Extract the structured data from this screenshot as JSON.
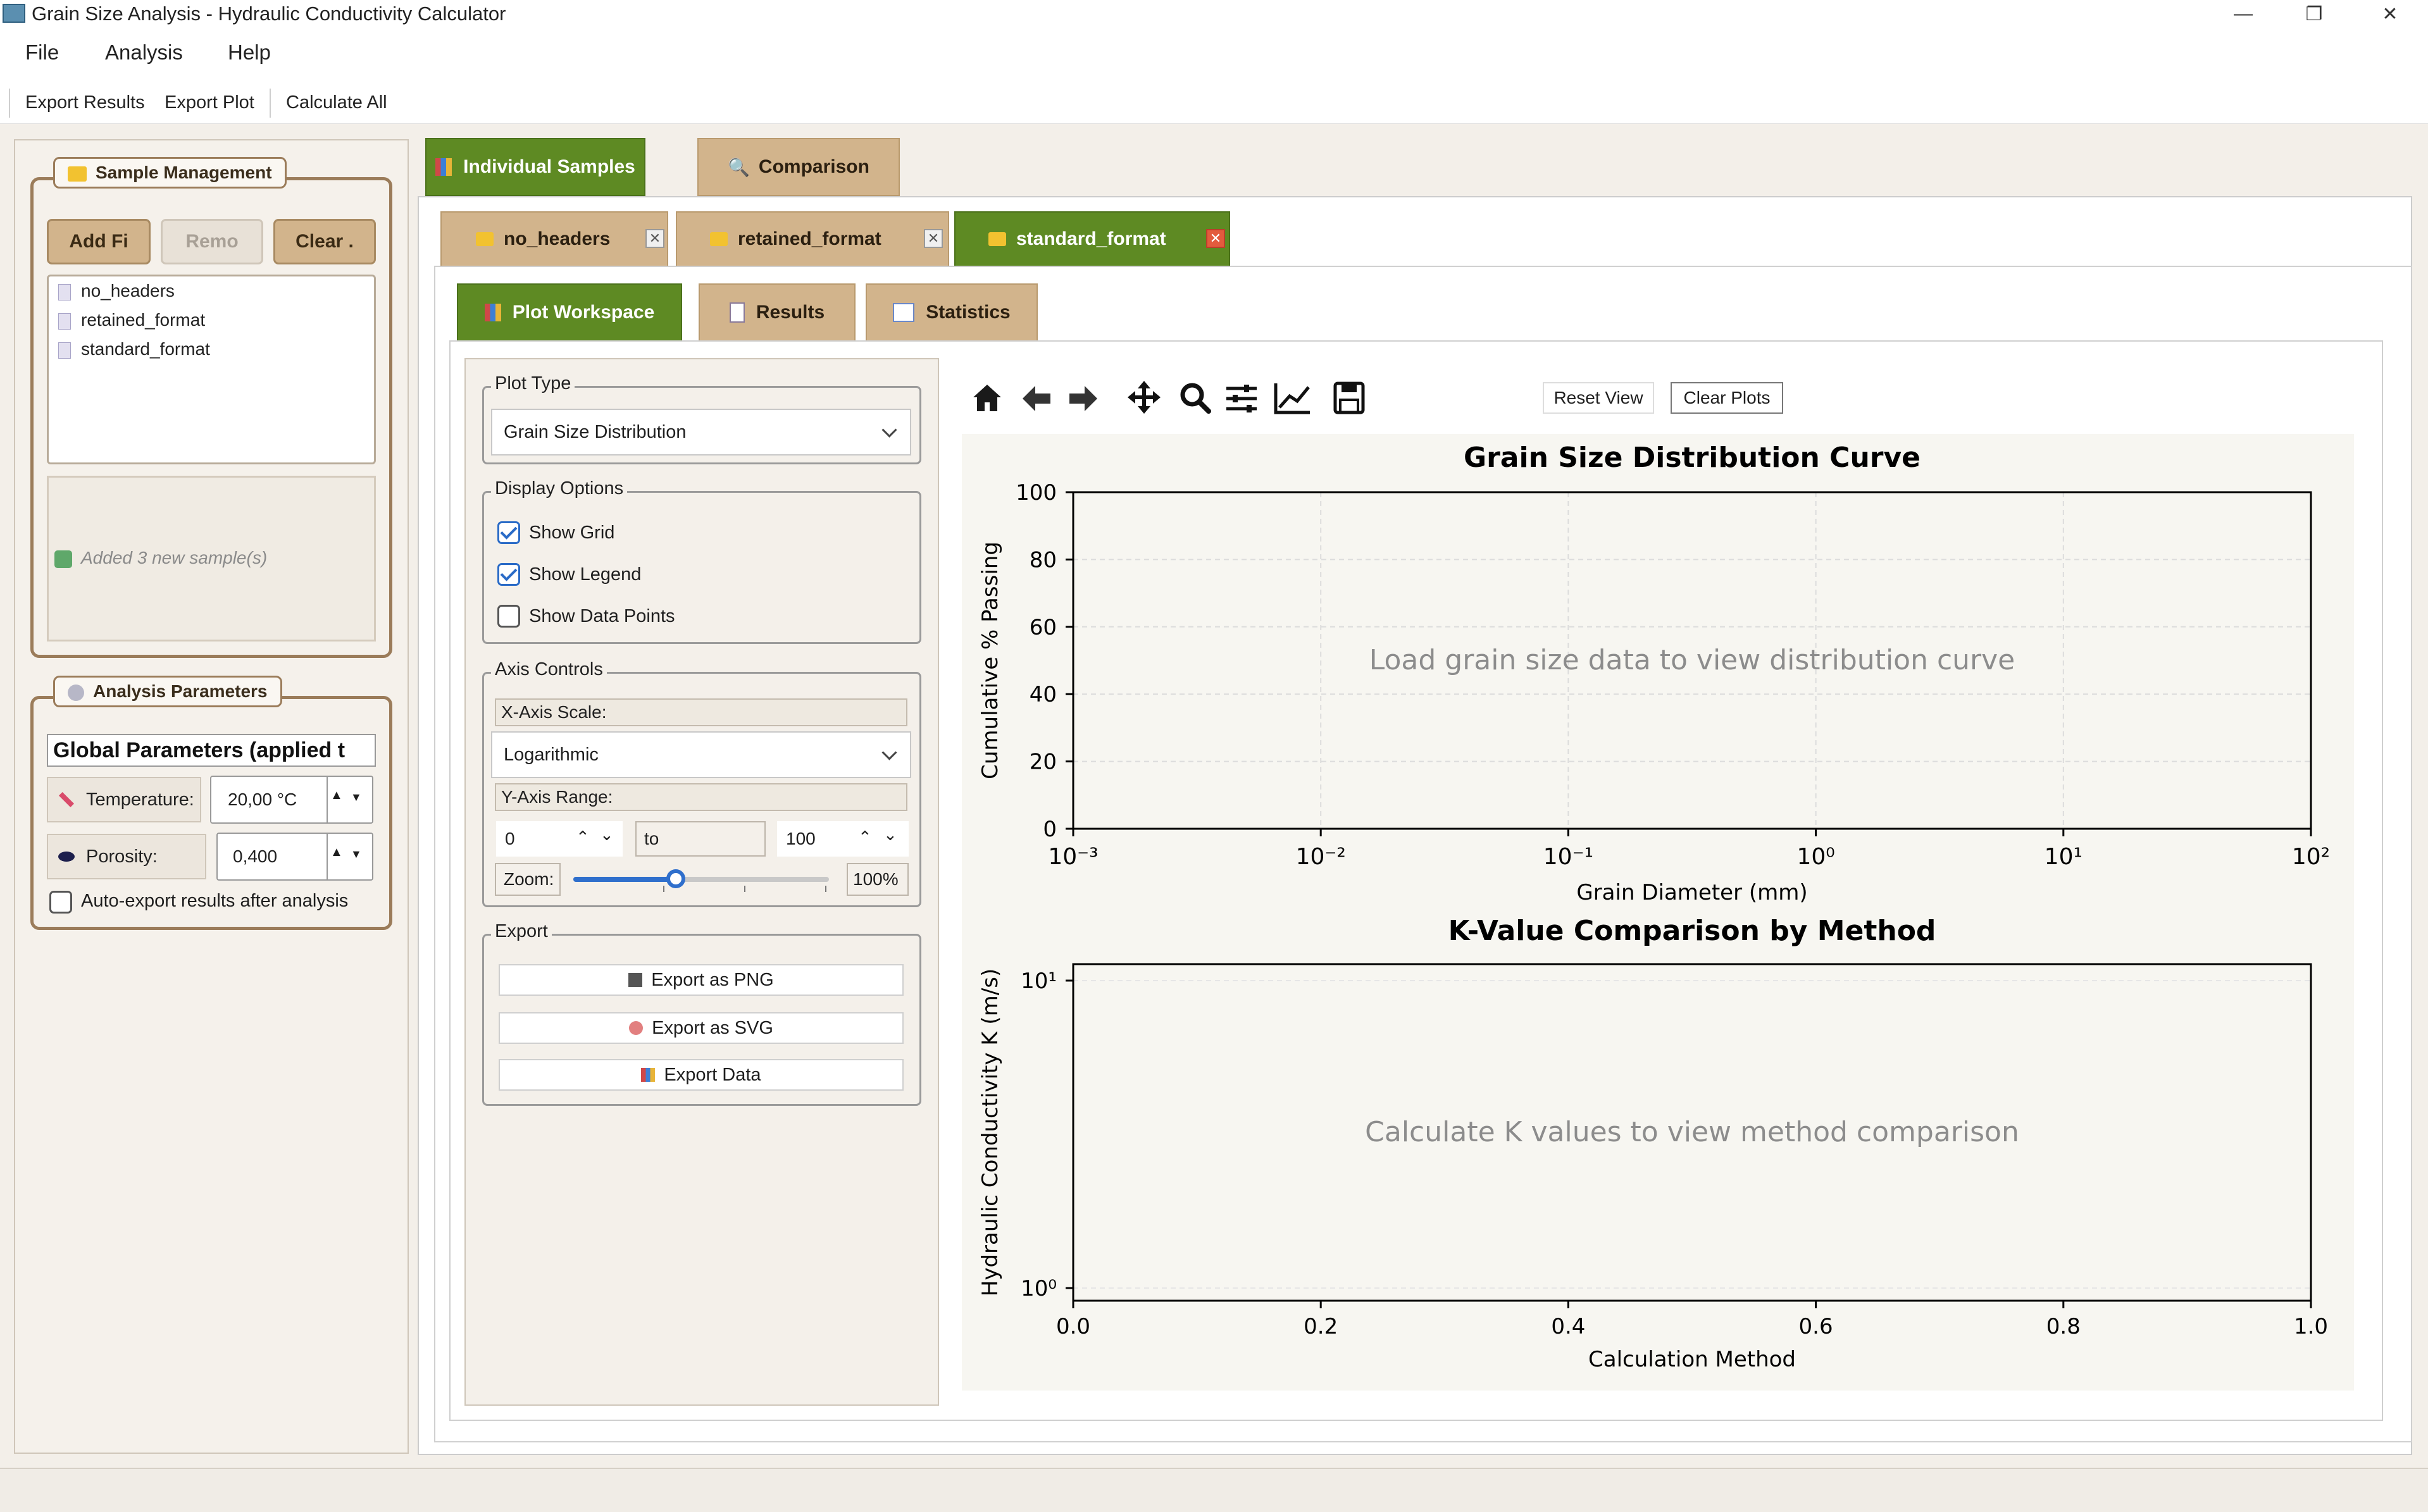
{
  "window": {
    "title": "Grain Size Analysis - Hydraulic Conductivity Calculator"
  },
  "menu": [
    "File",
    "Analysis",
    "Help"
  ],
  "toolbar": [
    "Export Results",
    "Export Plot",
    "Calculate All"
  ],
  "sample_management": {
    "title": "Sample Management",
    "buttons": [
      "Add Fi",
      "Remo",
      "Clear ."
    ],
    "samples": [
      "no_headers",
      "retained_format",
      "standard_format"
    ],
    "status": "Added 3 new sample(s)"
  },
  "analysis_parameters": {
    "title": "Analysis Parameters",
    "header": "Global Parameters (applied t",
    "temperature_label": "Temperature:",
    "temperature_value": "20,00 °C",
    "porosity_label": "Porosity:",
    "porosity_value": "0,400",
    "auto_export_label": "Auto-export results after analysis",
    "auto_export_checked": false
  },
  "main_tabs": [
    "Individual Samples",
    "Comparison"
  ],
  "sample_tabs": [
    "no_headers",
    "retained_format",
    "standard_format"
  ],
  "workspace_tabs": [
    "Plot Workspace",
    "Results",
    "Statistics"
  ],
  "plot_type": {
    "legend": "Plot Type",
    "selected": "Grain Size Distribution"
  },
  "display_options": {
    "legend": "Display Options",
    "items": [
      {
        "label": "Show Grid",
        "checked": true
      },
      {
        "label": "Show Legend",
        "checked": true
      },
      {
        "label": "Show Data Points",
        "checked": false
      }
    ]
  },
  "axis_controls": {
    "legend": "Axis Controls",
    "x_scale_label": "X-Axis Scale:",
    "x_scale_value": "Logarithmic",
    "y_range_label": "Y-Axis Range:",
    "y_min": "0",
    "to_label": "to",
    "y_max": "100",
    "zoom_label": "Zoom:",
    "zoom_value": "100%",
    "zoom_level": 0.4
  },
  "export": {
    "legend": "Export",
    "buttons": [
      "Export as PNG",
      "Export as SVG",
      "Export Data"
    ]
  },
  "plot_toolbar": {
    "icons": [
      "home-icon",
      "back-arrow-icon",
      "forward-arrow-icon",
      "pan-move-icon",
      "zoom-magnifier-icon",
      "configure-subplots-icon",
      "edit-axes-icon",
      "save-disk-icon"
    ],
    "reset_view": "Reset View",
    "clear_plots": "Clear Plots"
  },
  "chart_data": [
    {
      "type": "line",
      "title": "Grain Size Distribution Curve",
      "xlabel": "Grain Diameter (mm)",
      "ylabel": "Cumulative % Passing",
      "xscale": "log",
      "xlim": [
        0.001,
        100
      ],
      "ylim": [
        0,
        100
      ],
      "xticks": [
        "10⁻³",
        "10⁻²",
        "10⁻¹",
        "10⁰",
        "10¹",
        "10²"
      ],
      "yticks": [
        "0",
        "20",
        "40",
        "60",
        "80",
        "100"
      ],
      "grid": true,
      "series": [],
      "placeholder": "Load grain size data to view distribution curve"
    },
    {
      "type": "bar",
      "title": "K-Value Comparison by Method",
      "xlabel": "Calculation Method",
      "ylabel": "Hydraulic Conductivity K (m/s)",
      "yscale": "log",
      "xlim": [
        0.0,
        1.0
      ],
      "xticks": [
        "0.0",
        "0.2",
        "0.4",
        "0.6",
        "0.8",
        "1.0"
      ],
      "yticks": [
        "10⁰",
        "10¹"
      ],
      "grid": true,
      "series": [],
      "placeholder": "Calculate K values to view method comparison"
    }
  ]
}
